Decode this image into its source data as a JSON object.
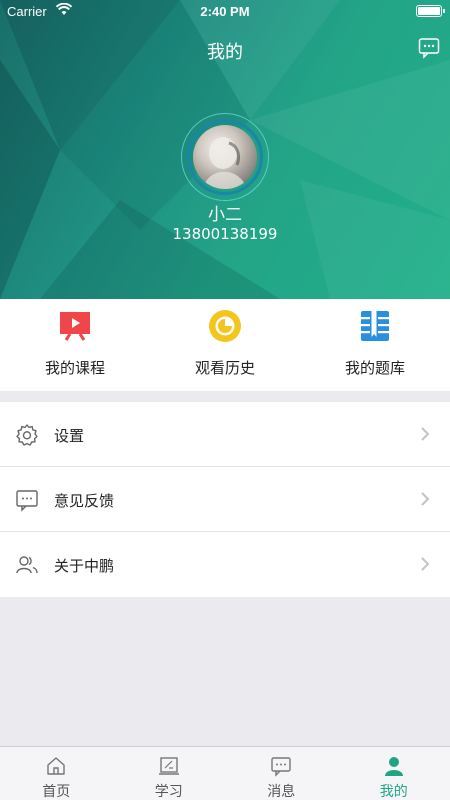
{
  "status_bar": {
    "carrier": "Carrier",
    "time": "2:40 PM"
  },
  "nav": {
    "title": "我的",
    "message_icon": "message-dots-icon"
  },
  "profile": {
    "name": "小二",
    "phone": "13800138199"
  },
  "quick_actions": [
    {
      "label": "我的课程",
      "icon": "video-course-icon",
      "color": "#f0464a"
    },
    {
      "label": "观看历史",
      "icon": "eye-history-icon",
      "color": "#f4c51c"
    },
    {
      "label": "我的题库",
      "icon": "question-bank-icon",
      "color": "#2b8fe0"
    }
  ],
  "menu": [
    {
      "label": "设置",
      "icon": "gear-icon"
    },
    {
      "label": "意见反馈",
      "icon": "feedback-icon"
    },
    {
      "label": "关于中鹏",
      "icon": "users-icon"
    }
  ],
  "tabs": [
    {
      "label": "首页",
      "icon": "home-icon",
      "active": false
    },
    {
      "label": "学习",
      "icon": "study-icon",
      "active": false
    },
    {
      "label": "消息",
      "icon": "message-icon",
      "active": false
    },
    {
      "label": "我的",
      "icon": "person-icon",
      "active": true
    }
  ],
  "colors": {
    "accent": "#1fa584",
    "header": "#21b08a"
  }
}
